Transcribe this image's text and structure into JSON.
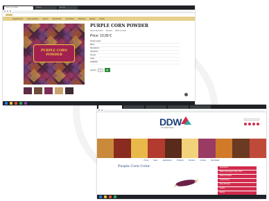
{
  "colors": {
    "accent_gold": "#e4cf8b",
    "product_purple": "#5b2b47",
    "add_green": "#2f8a3e",
    "ddw_navy": "#1c3f78",
    "ddw_red": "#d02b4c",
    "taskbar": "#1f2228"
  },
  "window1": {
    "tabs": [
      "Purple Corn Powder",
      "Products",
      "New Tab"
    ],
    "url": "",
    "nav_items": [
      "Supplements",
      "Food powders",
      "Spices",
      "Superfoods",
      "Smoothies",
      "Wellness",
      "Beauty",
      "Drinks"
    ],
    "product": {
      "title": "PURPLE CORN POWDER",
      "label_text": "PURPLE CORN POWDER",
      "meta": [
        "Add to favourites",
        "Reviews",
        "Write a review"
      ],
      "sku": "",
      "price": "Price: 10,99 €",
      "specs": [
        {
          "k": "Product weight",
          "v": ""
        },
        {
          "k": "Brand",
          "v": ""
        },
        {
          "k": "Manufacturer",
          "v": ""
        },
        {
          "k": "Ingredients",
          "v": ""
        },
        {
          "k": "Serving",
          "v": ""
        },
        {
          "k": "Origin",
          "v": ""
        },
        {
          "k": "Availability",
          "v": ""
        }
      ],
      "qty_label": "Quantity",
      "qty_value": "1",
      "add_label": "▶",
      "description": ""
    },
    "taskbar_clock": ""
  },
  "window2": {
    "tabs": [
      "",
      "",
      "",
      "",
      ""
    ],
    "logo": "DDW",
    "tagline": "The Colour House",
    "top_links": "",
    "nav_items": [
      "Home",
      "News",
      "Applications",
      "Products",
      "Services",
      "Contact",
      "Downloads"
    ],
    "title": "Purple Corn Color",
    "body": "",
    "sidebar": [
      "Applications",
      "Bakery, Beverages, Dairy, Other",
      "Sauces & Soups",
      "Confectionery",
      "Dairy Products",
      "Snacks",
      "Savory"
    ],
    "taskbar_clock": ""
  }
}
